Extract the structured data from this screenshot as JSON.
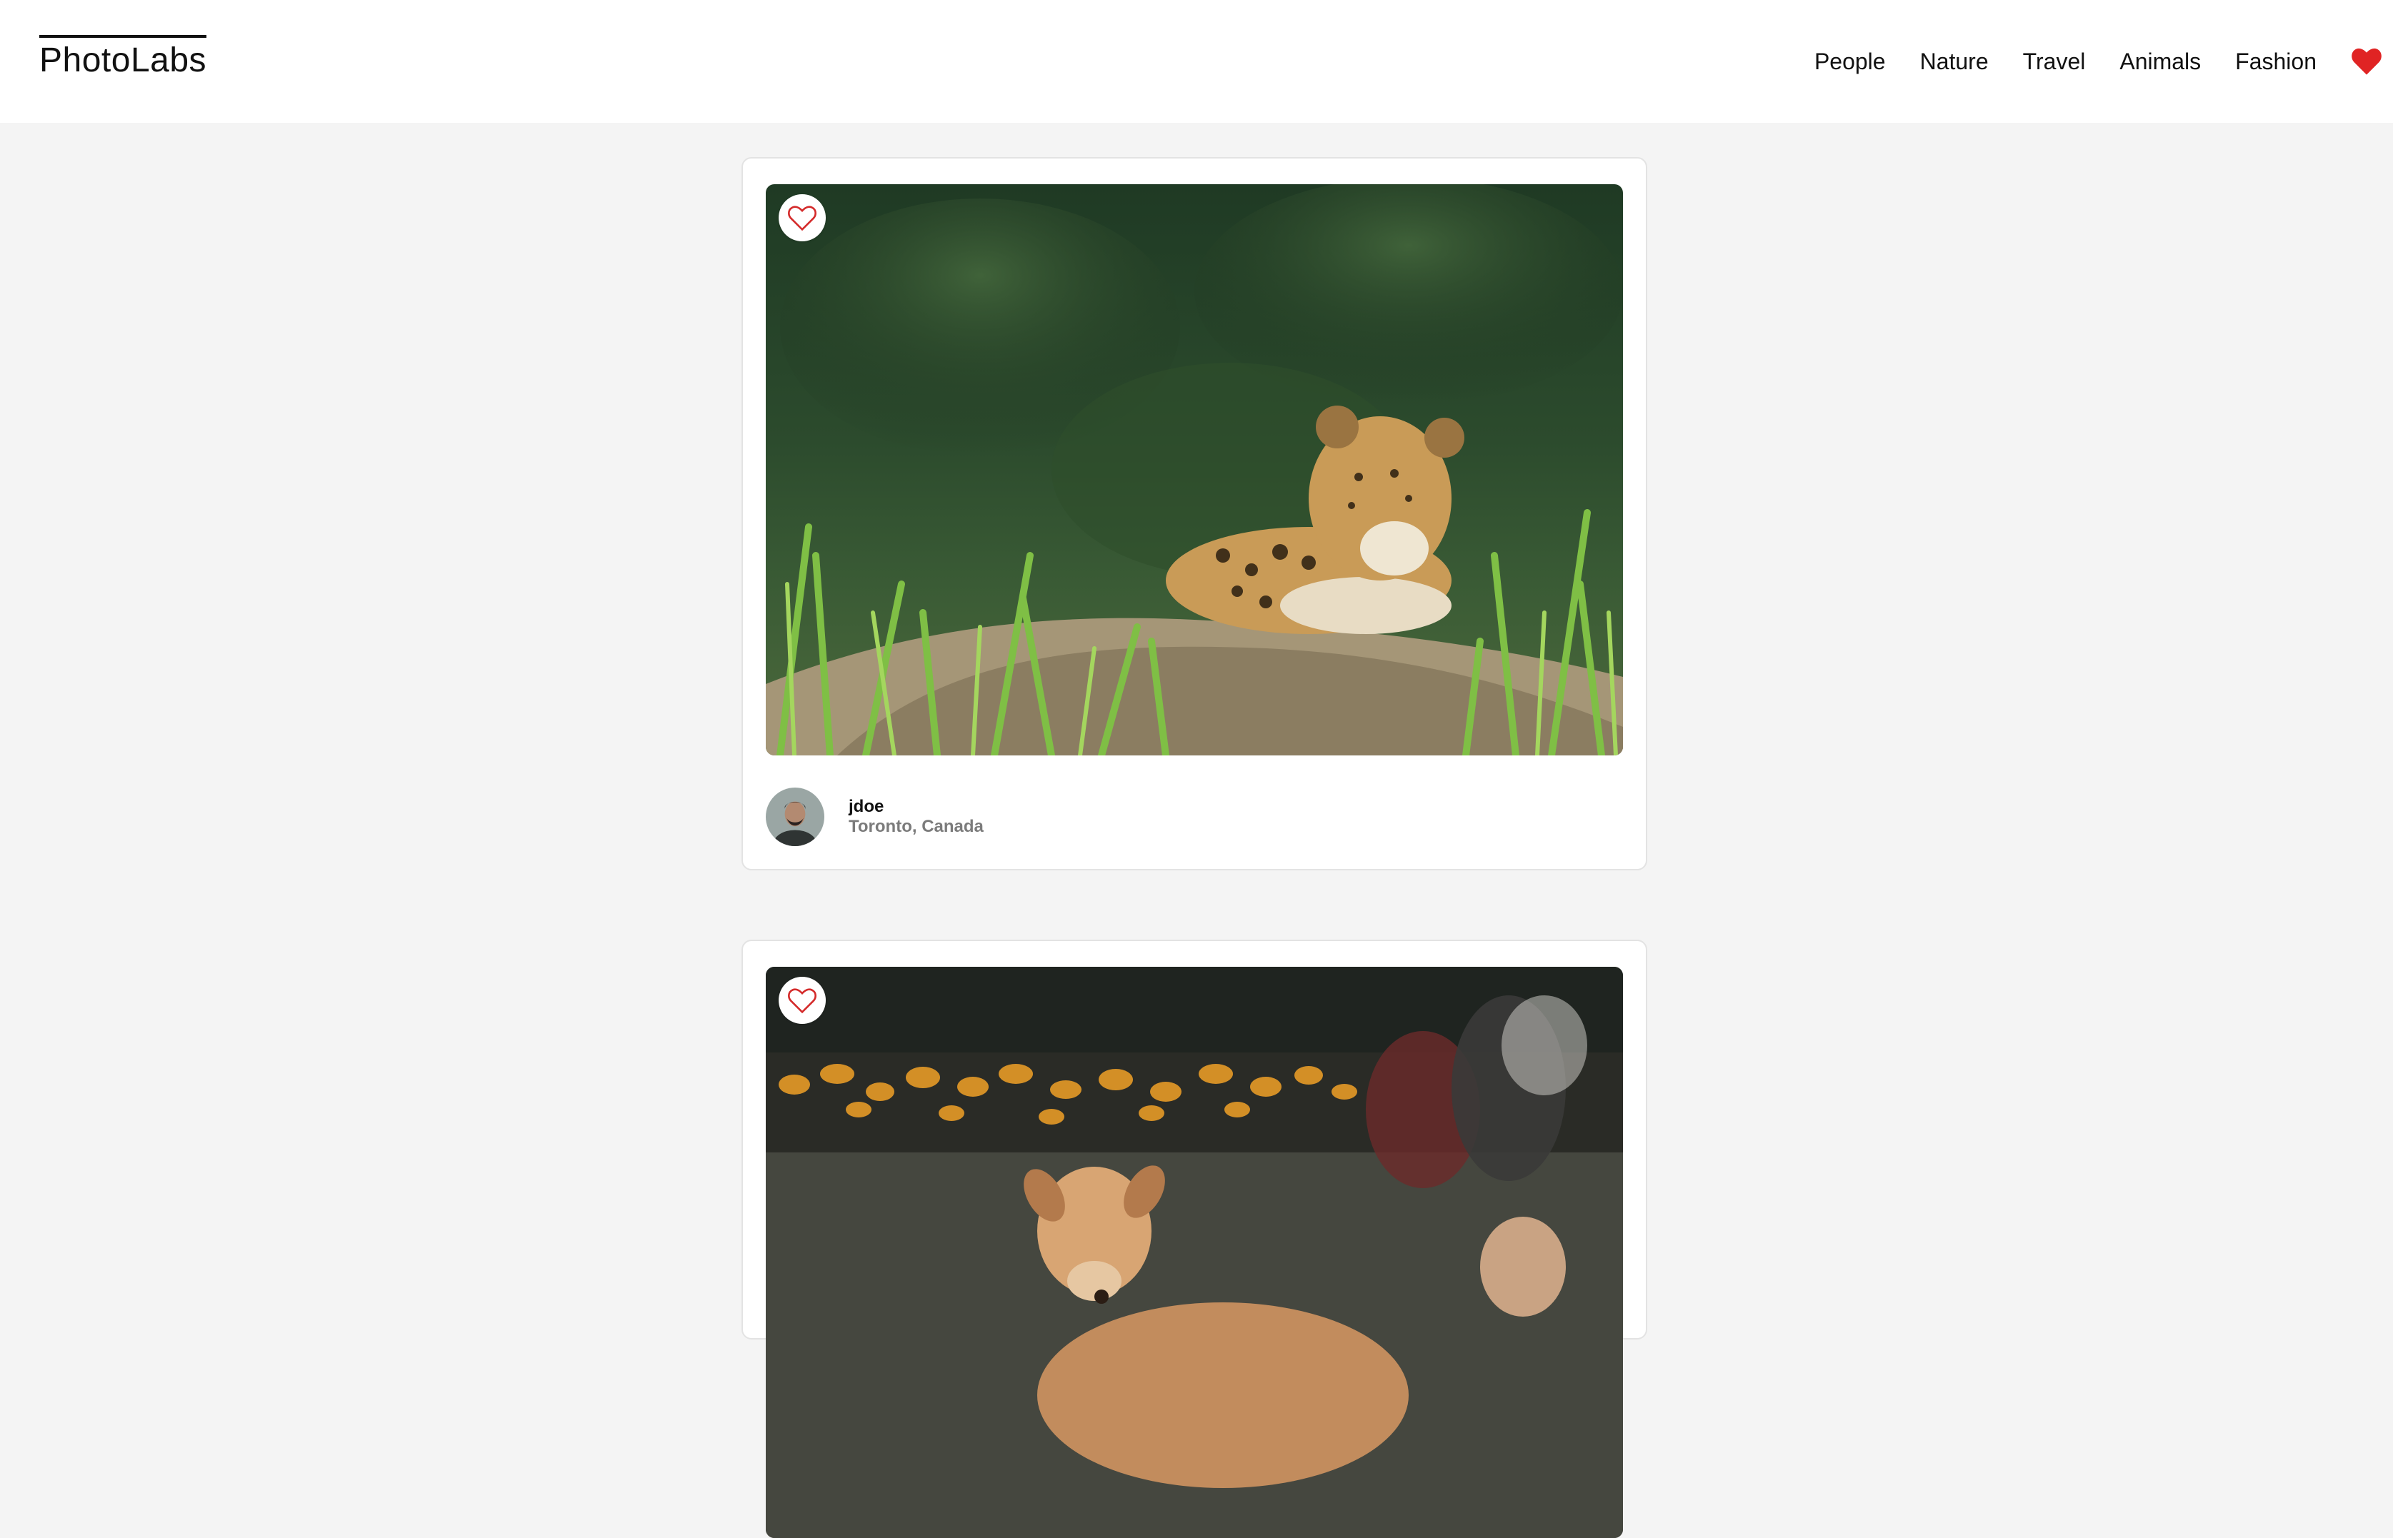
{
  "app": {
    "logo": "PhotoLabs"
  },
  "nav": {
    "topics": [
      {
        "label": "People"
      },
      {
        "label": "Nature"
      },
      {
        "label": "Travel"
      },
      {
        "label": "Animals"
      },
      {
        "label": "Fashion"
      }
    ],
    "favourites_icon": "heart-icon",
    "favourites_color": "#e02424"
  },
  "photos": [
    {
      "subject": "jaguar",
      "username": "jdoe",
      "location": "Toronto, Canada",
      "liked": false,
      "like_icon": "heart-outline-icon"
    },
    {
      "subject": "dog",
      "liked": false,
      "like_icon": "heart-outline-icon"
    }
  ]
}
